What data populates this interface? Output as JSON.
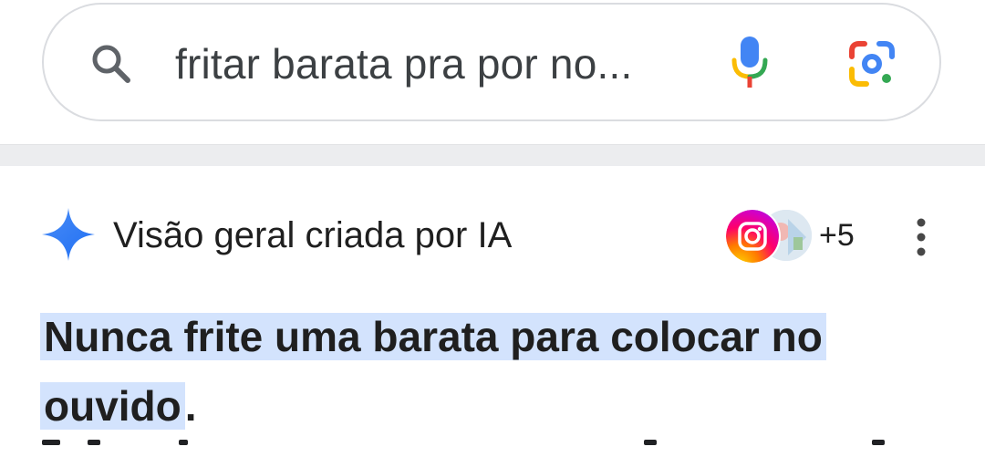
{
  "search": {
    "query": "fritar barata pra por no...",
    "icons": [
      "search-icon",
      "mic-icon",
      "google-lens-icon"
    ]
  },
  "ai_overview": {
    "title": "Visão geral criada por IA",
    "icon": "sparkle-icon",
    "sources": {
      "icons": [
        "instagram-icon",
        "source-thumbnail"
      ],
      "more_count": "+5"
    },
    "more_options_icon": "more-vertical-icon",
    "answer": {
      "line1": "Nunca frite uma barata para colocar no",
      "line2": "ouvido",
      "punctuation": "."
    }
  },
  "colors": {
    "highlight": "#d3e3fd",
    "google_blue": "#4285f4",
    "google_red": "#ea4335",
    "google_yellow": "#fbbc04",
    "google_green": "#34a853"
  }
}
